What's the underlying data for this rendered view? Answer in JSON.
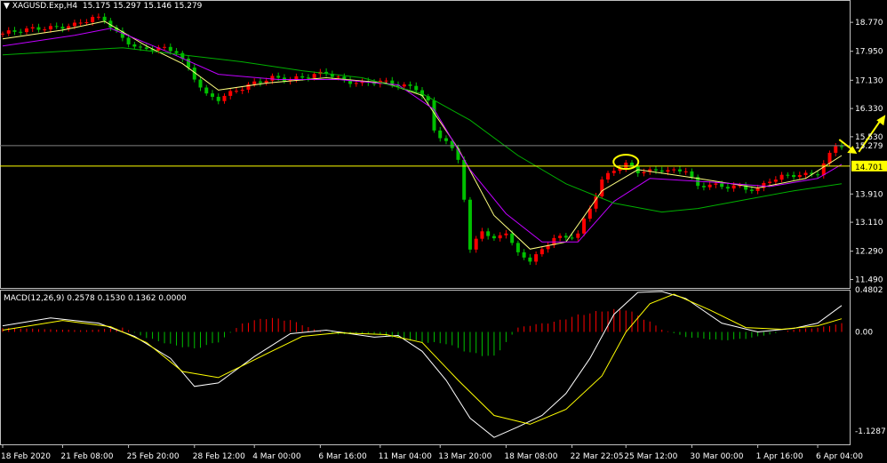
{
  "header": {
    "symbol": "XAGUSD.Exp,H4",
    "ohlc": "15.175 15.297 15.146 15.279"
  },
  "macd_header": {
    "label": "MACD(12,26,9)",
    "values": "0.2578 0.1530 0.1362 0.0000"
  },
  "colors": {
    "background": "#000000",
    "grid_frame": "#c0c0c0",
    "bull_candle": "#ff0000",
    "bear_candle": "#00c000",
    "ma_fast": "#ffff80",
    "ma_mid": "#c000ff",
    "ma_slow": "#00b000",
    "horizontal_level": "#ffff00",
    "current_price_line": "#808080",
    "arrows": "#ffff00",
    "macd_main": "#ffffff",
    "macd_signal": "#ffff00"
  },
  "chart_data": [
    {
      "type": "candlestick",
      "title": "XAGUSD.Exp,H4",
      "ylim": [
        11.25,
        19.05
      ],
      "y_ticks": [
        "18.770",
        "17.950",
        "17.130",
        "16.330",
        "15.530",
        "13.910",
        "13.110",
        "12.290",
        "11.490"
      ],
      "x_ticks": [
        "18 Feb 2020",
        "21 Feb 08:00",
        "25 Feb 20:00",
        "28 Feb 12:00",
        "4 Mar 00:00",
        "6 Mar 16:00",
        "11 Mar 04:00",
        "13 Mar 20:00",
        "18 Mar 08:00",
        "22 Mar 22:05",
        "25 Mar 12:00",
        "30 Mar 00:00",
        "1 Apr 16:00",
        "6 Apr 04:00"
      ],
      "price_tags": [
        {
          "label": "15.279",
          "value": 15.279,
          "role": "current"
        },
        {
          "label": "14.701",
          "value": 14.701,
          "role": "level"
        }
      ],
      "close_path": [
        [
          0,
          18.45
        ],
        [
          3,
          18.55
        ],
        [
          6,
          18.6
        ],
        [
          9,
          18.62
        ],
        [
          12,
          18.7
        ],
        [
          15,
          18.9
        ],
        [
          17,
          18.85
        ],
        [
          20,
          18.3
        ],
        [
          23,
          18.0
        ],
        [
          26,
          18.05
        ],
        [
          29,
          17.95
        ],
        [
          32,
          17.2
        ],
        [
          34,
          16.7
        ],
        [
          36,
          16.6
        ],
        [
          39,
          16.85
        ],
        [
          42,
          17.05
        ],
        [
          45,
          17.2
        ],
        [
          48,
          17.15
        ],
        [
          51,
          17.25
        ],
        [
          54,
          17.35
        ],
        [
          57,
          17.1
        ],
        [
          60,
          17.05
        ],
        [
          63,
          17.1
        ],
        [
          66,
          17.0
        ],
        [
          69,
          16.9
        ],
        [
          71,
          16.5
        ],
        [
          72,
          15.7
        ],
        [
          74,
          15.4
        ],
        [
          76,
          14.9
        ],
        [
          77,
          13.8
        ],
        [
          78,
          12.3
        ],
        [
          80,
          12.9
        ],
        [
          82,
          12.6
        ],
        [
          84,
          12.85
        ],
        [
          86,
          12.2
        ],
        [
          88,
          12.05
        ],
        [
          90,
          12.3
        ],
        [
          92,
          12.7
        ],
        [
          94,
          12.65
        ],
        [
          96,
          12.8
        ],
        [
          98,
          13.5
        ],
        [
          100,
          14.3
        ],
        [
          102,
          14.6
        ],
        [
          104,
          14.75
        ],
        [
          106,
          14.55
        ],
        [
          108,
          14.55
        ],
        [
          110,
          14.6
        ],
        [
          112,
          14.55
        ],
        [
          114,
          14.6
        ],
        [
          116,
          14.1
        ],
        [
          118,
          14.2
        ],
        [
          120,
          14.1
        ],
        [
          122,
          14.15
        ],
        [
          124,
          14.05
        ],
        [
          126,
          14.05
        ],
        [
          128,
          14.3
        ],
        [
          130,
          14.4
        ],
        [
          132,
          14.45
        ],
        [
          134,
          14.45
        ],
        [
          136,
          14.5
        ],
        [
          137,
          14.75
        ],
        [
          139,
          15.3
        ],
        [
          140,
          15.28
        ]
      ],
      "series": [
        {
          "name": "",
          "role": "ma_fast",
          "values": [
            [
              0,
              18.3
            ],
            [
              10,
              18.55
            ],
            [
              17,
              18.8
            ],
            [
              24,
              18.1
            ],
            [
              30,
              17.6
            ],
            [
              36,
              16.85
            ],
            [
              44,
              17.05
            ],
            [
              54,
              17.2
            ],
            [
              64,
              17.05
            ],
            [
              70,
              16.7
            ],
            [
              76,
              15.2
            ],
            [
              82,
              13.3
            ],
            [
              88,
              12.35
            ],
            [
              94,
              12.55
            ],
            [
              100,
              14.0
            ],
            [
              106,
              14.6
            ],
            [
              116,
              14.35
            ],
            [
              126,
              14.08
            ],
            [
              134,
              14.35
            ],
            [
              140,
              15.0
            ]
          ]
        },
        {
          "name": "",
          "role": "ma_mid",
          "values": [
            [
              0,
              18.1
            ],
            [
              12,
              18.4
            ],
            [
              18,
              18.6
            ],
            [
              28,
              17.9
            ],
            [
              36,
              17.3
            ],
            [
              46,
              17.15
            ],
            [
              56,
              17.15
            ],
            [
              66,
              17.0
            ],
            [
              72,
              16.3
            ],
            [
              78,
              14.6
            ],
            [
              84,
              13.35
            ],
            [
              90,
              12.55
            ],
            [
              96,
              12.55
            ],
            [
              102,
              13.7
            ],
            [
              108,
              14.35
            ],
            [
              118,
              14.25
            ],
            [
              128,
              14.12
            ],
            [
              136,
              14.35
            ],
            [
              140,
              14.75
            ]
          ]
        },
        {
          "name": "",
          "role": "ma_slow",
          "values": [
            [
              0,
              17.85
            ],
            [
              20,
              18.05
            ],
            [
              30,
              17.85
            ],
            [
              40,
              17.65
            ],
            [
              50,
              17.4
            ],
            [
              60,
              17.2
            ],
            [
              70,
              16.75
            ],
            [
              78,
              16.0
            ],
            [
              86,
              15.0
            ],
            [
              94,
              14.2
            ],
            [
              102,
              13.65
            ],
            [
              110,
              13.4
            ],
            [
              116,
              13.5
            ],
            [
              124,
              13.75
            ],
            [
              132,
              14.0
            ],
            [
              140,
              14.2
            ]
          ]
        }
      ]
    },
    {
      "type": "macd",
      "title": "MACD(12,26,9)",
      "ylim": [
        -1.2787,
        0.4802
      ],
      "y_ticks": [
        "0.4802",
        "0.00",
        "-1.1287"
      ],
      "main": [
        [
          0,
          0.07
        ],
        [
          8,
          0.16
        ],
        [
          16,
          0.1
        ],
        [
          22,
          -0.05
        ],
        [
          28,
          -0.3
        ],
        [
          32,
          -0.62
        ],
        [
          36,
          -0.58
        ],
        [
          42,
          -0.28
        ],
        [
          48,
          -0.02
        ],
        [
          54,
          0.02
        ],
        [
          58,
          -0.02
        ],
        [
          62,
          -0.06
        ],
        [
          66,
          -0.04
        ],
        [
          70,
          -0.22
        ],
        [
          74,
          -0.55
        ],
        [
          78,
          -0.98
        ],
        [
          82,
          -1.2
        ],
        [
          86,
          -1.08
        ],
        [
          90,
          -0.95
        ],
        [
          94,
          -0.7
        ],
        [
          98,
          -0.3
        ],
        [
          102,
          0.2
        ],
        [
          106,
          0.45
        ],
        [
          110,
          0.46
        ],
        [
          114,
          0.38
        ],
        [
          120,
          0.1
        ],
        [
          126,
          0.0
        ],
        [
          132,
          0.04
        ],
        [
          136,
          0.1
        ],
        [
          140,
          0.3
        ]
      ],
      "signal": [
        [
          0,
          0.02
        ],
        [
          10,
          0.13
        ],
        [
          18,
          0.06
        ],
        [
          24,
          -0.12
        ],
        [
          30,
          -0.45
        ],
        [
          36,
          -0.52
        ],
        [
          44,
          -0.25
        ],
        [
          50,
          -0.05
        ],
        [
          56,
          -0.01
        ],
        [
          64,
          -0.03
        ],
        [
          70,
          -0.12
        ],
        [
          76,
          -0.55
        ],
        [
          82,
          -0.95
        ],
        [
          88,
          -1.05
        ],
        [
          94,
          -0.88
        ],
        [
          100,
          -0.5
        ],
        [
          104,
          0.0
        ],
        [
          108,
          0.32
        ],
        [
          112,
          0.43
        ],
        [
          118,
          0.25
        ],
        [
          124,
          0.05
        ],
        [
          130,
          0.03
        ],
        [
          136,
          0.07
        ],
        [
          140,
          0.15
        ]
      ],
      "histogram": [
        [
          0,
          0.05
        ],
        [
          8,
          0.03
        ],
        [
          14,
          0.02
        ],
        [
          20,
          0.05
        ],
        [
          24,
          -0.07
        ],
        [
          28,
          -0.15
        ],
        [
          32,
          -0.2
        ],
        [
          36,
          -0.12
        ],
        [
          40,
          0.1
        ],
        [
          44,
          0.17
        ],
        [
          48,
          0.14
        ],
        [
          52,
          0.03
        ],
        [
          56,
          -0.03
        ],
        [
          62,
          -0.02
        ],
        [
          66,
          -0.08
        ],
        [
          70,
          -0.12
        ],
        [
          74,
          -0.14
        ],
        [
          78,
          -0.25
        ],
        [
          82,
          -0.3
        ],
        [
          84,
          -0.12
        ],
        [
          86,
          0.05
        ],
        [
          88,
          0.08
        ],
        [
          92,
          0.12
        ],
        [
          96,
          0.2
        ],
        [
          100,
          0.25
        ],
        [
          104,
          0.27
        ],
        [
          108,
          0.12
        ],
        [
          110,
          0.03
        ],
        [
          114,
          -0.06
        ],
        [
          120,
          -0.1
        ],
        [
          124,
          -0.08
        ],
        [
          128,
          -0.03
        ],
        [
          132,
          0.03
        ],
        [
          136,
          0.05
        ],
        [
          140,
          0.1
        ]
      ]
    }
  ]
}
